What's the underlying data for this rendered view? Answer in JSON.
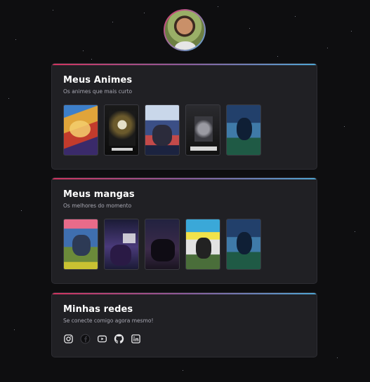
{
  "profile": {
    "avatar_alt": "Foto de perfil"
  },
  "sections": {
    "animes": {
      "title": "Meus Animes",
      "subtitle": "Os animes que mais curto",
      "covers": [
        "one-piece-cover",
        "overlord-cover",
        "demon-slayer-cover",
        "tokyo-ghoul-cover",
        "blue-night-cover"
      ]
    },
    "mangas": {
      "title": "Meus mangas",
      "subtitle": "Os melhores do momento",
      "covers": [
        "shaman-king-cover",
        "new-gate-cover",
        "night-party-cover",
        "shangri-la-frontier-cover",
        "blue-night-cover"
      ]
    },
    "redes": {
      "title": "Minhas redes",
      "subtitle": "Se conecte comigo agora mesmo!",
      "icons": [
        "instagram-icon",
        "facebook-icon",
        "youtube-icon",
        "github-icon",
        "linkedin-icon"
      ]
    }
  },
  "colors": {
    "background": "#0e0e10",
    "card": "#202024",
    "accent_start": "#d1345f",
    "accent_end": "#4fa6d4"
  }
}
